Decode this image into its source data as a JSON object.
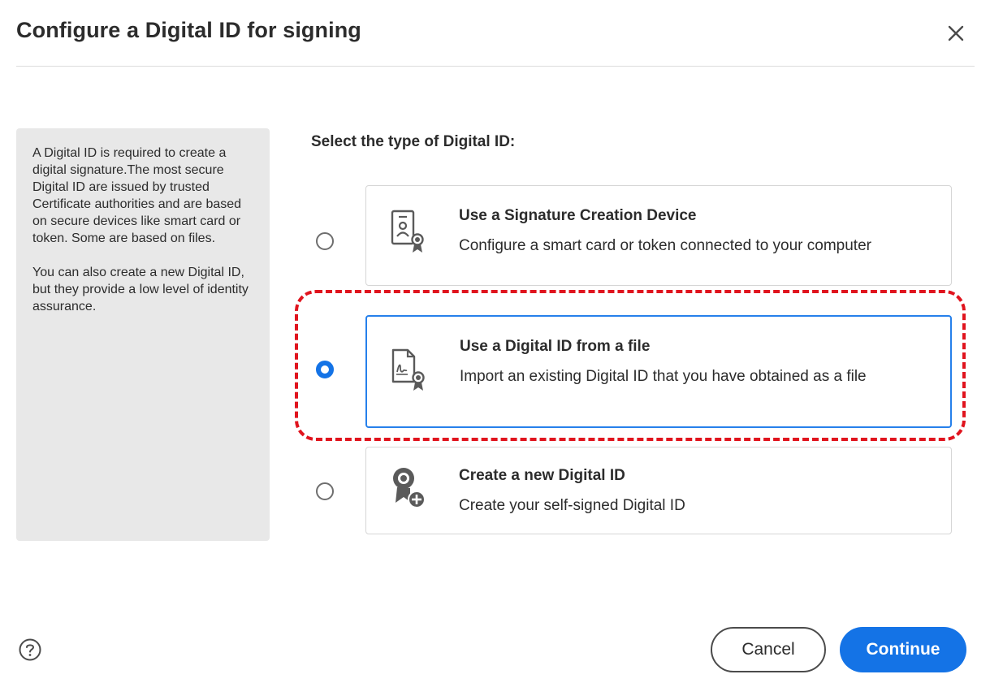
{
  "dialog": {
    "title": "Configure a Digital ID for signing",
    "close_icon": "close-icon"
  },
  "info": {
    "paragraph1": "A Digital ID is required to create a digital signature.The most secure Digital ID are issued by trusted Certificate authorities and are based on secure devices like smart card or token. Some are based on files.",
    "paragraph2": "You can also create a new Digital ID, but they provide a low level of identity assurance."
  },
  "selection": {
    "heading": "Select the type of Digital ID:",
    "selected_index": 1,
    "options": [
      {
        "title": "Use a Signature Creation Device",
        "description": "Configure a smart card or token connected to your computer",
        "icon": "signature-device-icon",
        "checked": false
      },
      {
        "title": "Use a Digital ID from a file",
        "description": "Import an existing Digital ID that you have obtained as a file",
        "icon": "digital-id-file-icon",
        "checked": true
      },
      {
        "title": "Create a new Digital ID",
        "description": "Create your self-signed Digital ID",
        "icon": "create-digital-id-icon",
        "checked": false
      }
    ]
  },
  "footer": {
    "help_icon": "help-icon",
    "cancel_label": "Cancel",
    "continue_label": "Continue"
  },
  "colors": {
    "accent": "#1473e6",
    "highlight": "#e0141e",
    "panel": "#e8e8e8"
  }
}
